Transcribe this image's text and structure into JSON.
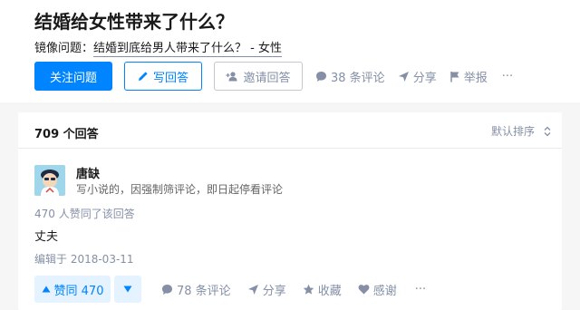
{
  "question": {
    "title": "结婚给女性带来了什么？",
    "mirror_prefix": "镜像问题：",
    "mirror_link": "结婚到底给男人带来了什么？ - 女性"
  },
  "actions": {
    "follow": "关注问题",
    "write": "写回答",
    "invite": "邀请回答",
    "comments": "38 条评论",
    "share": "分享",
    "report": "举报",
    "more": "···"
  },
  "answers": {
    "count": "709 个回答",
    "sort": "默认排序"
  },
  "answer": {
    "author": "唐缺",
    "bio": "写小说的，因强制筛评论，即日起停看评论",
    "votes_text": "470 人赞同了该回答",
    "content": "丈夫",
    "edited": "编辑于 2018-03-11",
    "upvote": "赞同 470",
    "comments": "78 条评论",
    "share": "分享",
    "collect": "收藏",
    "thanks": "感谢",
    "more": "···"
  },
  "colors": {
    "brand": "#0084ff",
    "muted": "#8590a6",
    "vote_bg": "#e5f2ff"
  },
  "icons": [
    "pencil-icon",
    "invite-icon",
    "comment-icon",
    "share-icon",
    "flag-icon",
    "sort-icon",
    "upvote-icon",
    "downvote-icon",
    "star-icon",
    "heart-icon"
  ]
}
